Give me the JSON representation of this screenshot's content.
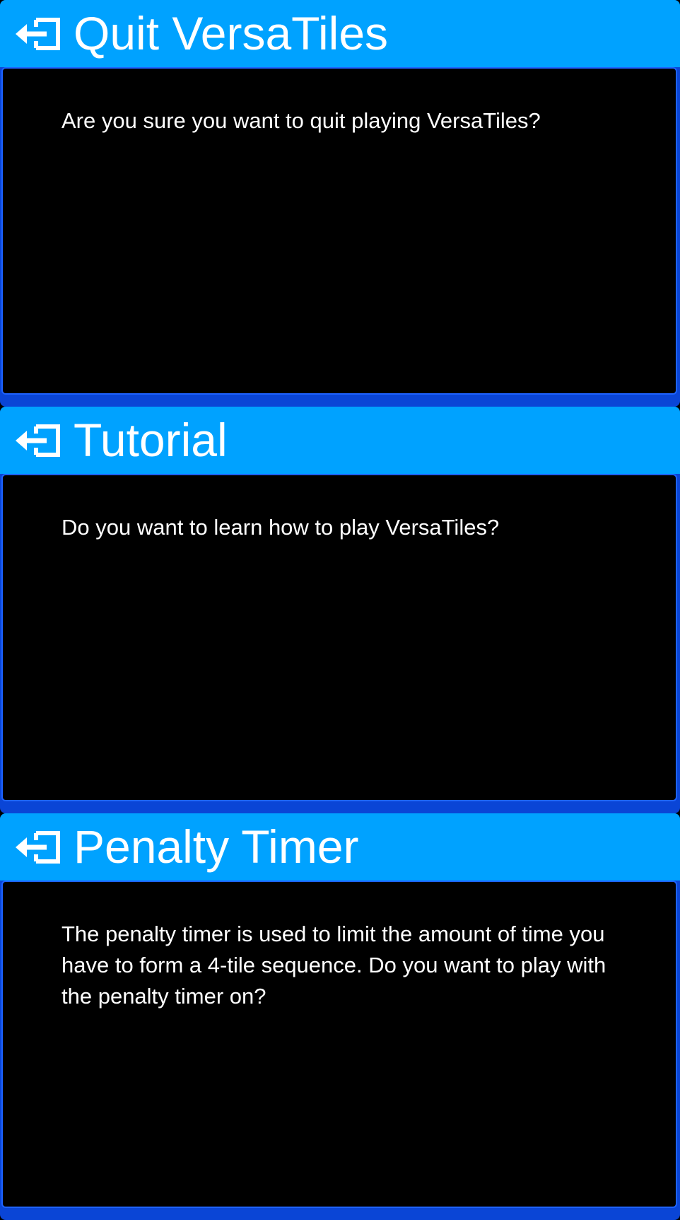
{
  "colors": {
    "header_background": "#00a2ff",
    "dialog_frame": "#0a45d6",
    "body_background": "#000000",
    "body_border": "#1e63ff",
    "text": "#ffffff"
  },
  "dialogs": [
    {
      "icon": "exit-icon",
      "title": "Quit VersaTiles",
      "message": "Are you sure you want to quit playing VersaTiles?"
    },
    {
      "icon": "exit-icon",
      "title": "Tutorial",
      "message": "Do you want to learn how to play VersaTiles?"
    },
    {
      "icon": "exit-icon",
      "title": "Penalty Timer",
      "message": "The penalty timer is used to limit the amount of time you have to form a 4-tile sequence. Do you want to play with the penalty timer on?"
    }
  ]
}
